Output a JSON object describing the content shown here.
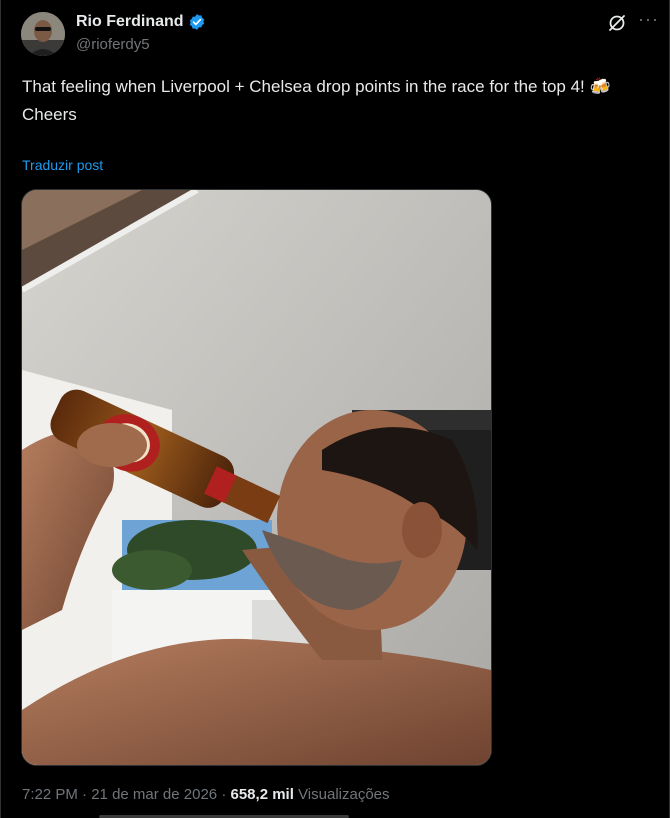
{
  "author": {
    "display_name": "Rio Ferdinand",
    "handle": "@rioferdy5",
    "verified_color": "#1d9bf0",
    "avatar_icon": "avatar-photo"
  },
  "header_actions": {
    "grok_icon": "grok-icon",
    "more_icon": "more-icon",
    "more_glyph": "···"
  },
  "post": {
    "text_line1": "That feeling when Liverpool + Chelsea drop points in the race for the top 4!",
    "emoji": "🍻",
    "text_line2": "Cheers",
    "translate_label": "Traduzir post"
  },
  "media": {
    "type": "photo"
  },
  "meta": {
    "time": "7:22 PM",
    "separator": "·",
    "date": "21 de mar de 2026",
    "views_count": "658,2 mil",
    "views_label": "Visualizações"
  },
  "colors": {
    "background": "#000000",
    "text_primary": "#e7e9ea",
    "text_secondary": "#71767b",
    "link": "#1d9bf0",
    "border": "#2f3336"
  }
}
